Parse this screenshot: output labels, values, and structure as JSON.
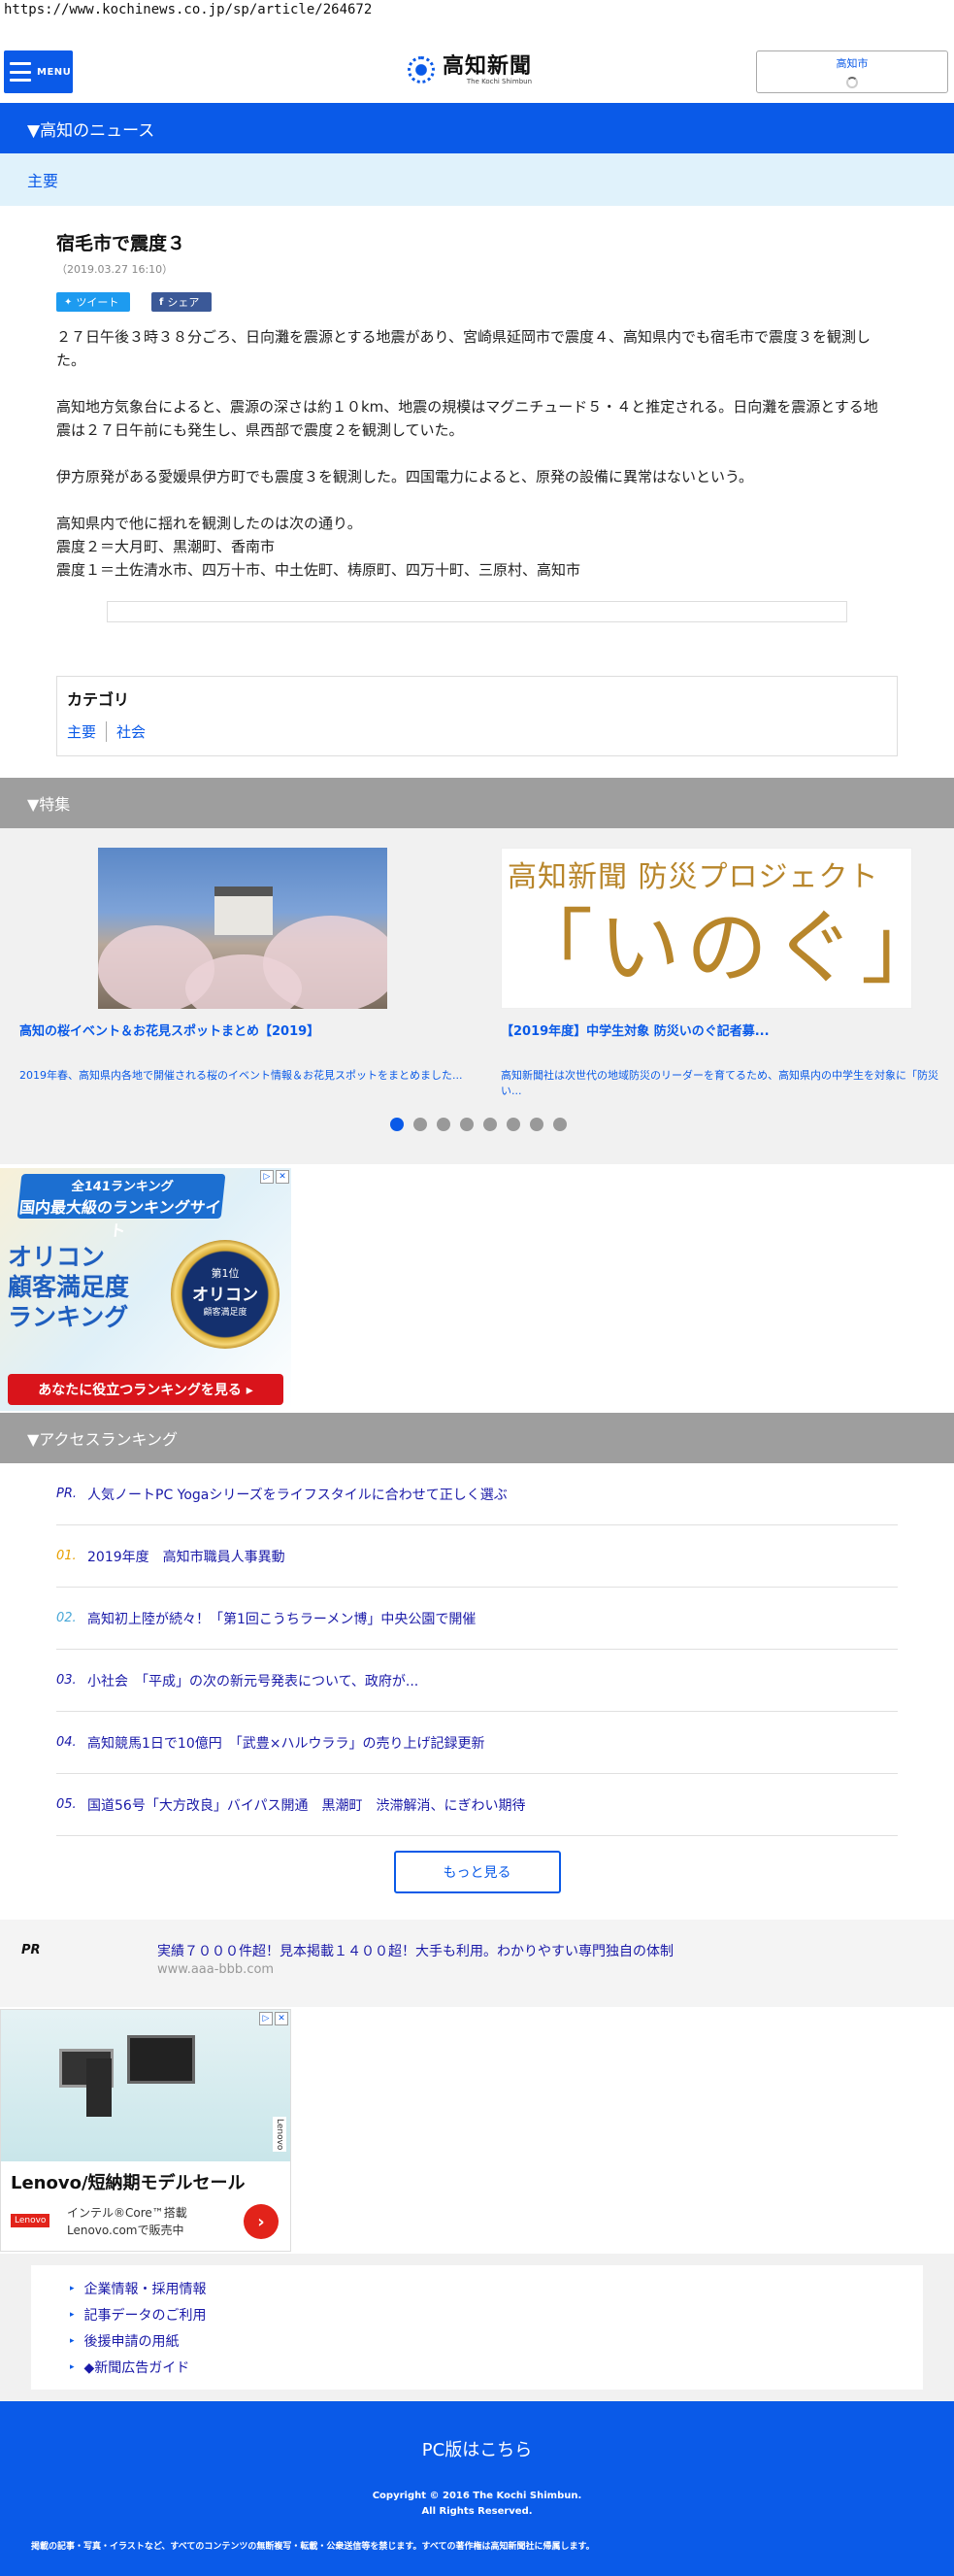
{
  "browser": {
    "url": "https://www.kochinews.co.jp/sp/article/264672"
  },
  "header": {
    "menu_label": "MENU",
    "logo_jp": "高知新聞",
    "logo_en": "The Kochi Shimbun",
    "weather_city": "高知市",
    "brand_color": "#0a5ae8"
  },
  "section_news": {
    "title": "▼高知のニュース",
    "sub": "主要"
  },
  "article": {
    "title": "宿毛市で震度３",
    "date": "（2019.03.27 16:10）",
    "share_twitter": "ツイート",
    "share_facebook": "シェア",
    "p1": "２７日午後３時３８分ごろ、日向灘を震源とする地震があり、宮崎県延岡市で震度４、高知県内でも宿毛市で震度３を観測した。",
    "p2": "高知地方気象台によると、震源の深さは約１０km、地震の規模はマグニチュード５・４と推定される。日向灘を震源とする地震は２７日午前にも発生し、県西部で震度２を観測していた。",
    "p3": "伊方原発がある愛媛県伊方町でも震度３を観測した。四国電力によると、原発の設備に異常はないという。",
    "p4_l1": "高知県内で他に揺れを観測したのは次の通り。",
    "p4_l2": "震度２＝大月町、黒潮町、香南市",
    "p4_l3": "震度１＝土佐清水市、四万十市、中土佐町、梼原町、四万十町、三原村、高知市"
  },
  "category": {
    "title": "カテゴリ",
    "links": [
      "主要",
      "社会"
    ]
  },
  "section_feature": {
    "title": "▼特集",
    "cards": [
      {
        "headline": "高知の桜イベント＆お花見スポットまとめ【2019】",
        "desc": "2019年春、高知県内各地で開催される桜のイベント情報＆お花見スポットをまとめました..."
      },
      {
        "image_title": "高知新聞 防災プロジェクト",
        "image_main": "「いのぐ」",
        "headline": "【2019年度】中学生対象 防災いのぐ記者募...",
        "desc": "高知新聞社は次世代の地域防災のリーダーを育てるため、高知県内の中学生を対象に「防災い..."
      }
    ],
    "dots_total": 8,
    "dots_active": 1
  },
  "ad_oricon": {
    "ribbon_top": "全141ランキング",
    "ribbon_bottom": "国内最大級のランキングサイト",
    "title_l1": "オリコン",
    "title_l2": "顧客満足度",
    "title_l3": "ランキング",
    "medal_l1": "第1位",
    "medal_l2": "オリコン",
    "medal_l3": "顧客満足度",
    "cta": "あなたに役立つランキングを見る ▸"
  },
  "section_ranking": {
    "title": "▼アクセスランキング",
    "items": [
      {
        "num": "PR.",
        "text": "人気ノートPC Yogaシリーズをライフスタイルに合わせて正しく選ぶ",
        "color": "#1a1aa8"
      },
      {
        "num": "01.",
        "text": "2019年度　高知市職員人事異動",
        "color": "#e8a000"
      },
      {
        "num": "02.",
        "text": "高知初上陸が続々！「第1回こうちラーメン博」中央公園で開催",
        "color": "#4aa8d8"
      },
      {
        "num": "03.",
        "text": "小社会　「平成」の次の新元号発表について、政府が...",
        "color": "#1a1aa8"
      },
      {
        "num": "04.",
        "text": "高知競馬1日で10億円　「武豊×ハルウララ」の売り上げ記録更新",
        "color": "#1a1aa8"
      },
      {
        "num": "05.",
        "text": "国道56号「大方改良」バイパス開通　黒潮町　渋滞解消、にぎわい期待",
        "color": "#1a1aa8"
      }
    ],
    "more_label": "もっと見る"
  },
  "pr_text_ad": {
    "label": "PR",
    "link": "実績７０００件超！見本掲載１４００超！大手も利用。わかりやすい専門独自の体制",
    "url": "www.aaa-bbb.com"
  },
  "ad_lenovo": {
    "side_label": "Lenovo",
    "title": "Lenovo/短納期モデルセール",
    "logo": "Lenovo",
    "sub_l1": "インテル®Core™搭載",
    "sub_l2": "Lenovo.comで販売中",
    "go": "›"
  },
  "footer": {
    "links": [
      "企業情報・採用情報",
      "記事データのご利用",
      "後援申請の用紙",
      "◆新聞広告ガイド"
    ],
    "pc_link": "PC版はこちら",
    "copyright_l1": "Copyright © 2016 The Kochi Shimbun.",
    "copyright_l2": "All Rights Reserved.",
    "notice": "掲載の記事・写真・イラストなど、すべてのコンテンツの無断複写・転載・公衆送信等を禁じます。すべての著作権は高知新聞社に帰属します。"
  }
}
